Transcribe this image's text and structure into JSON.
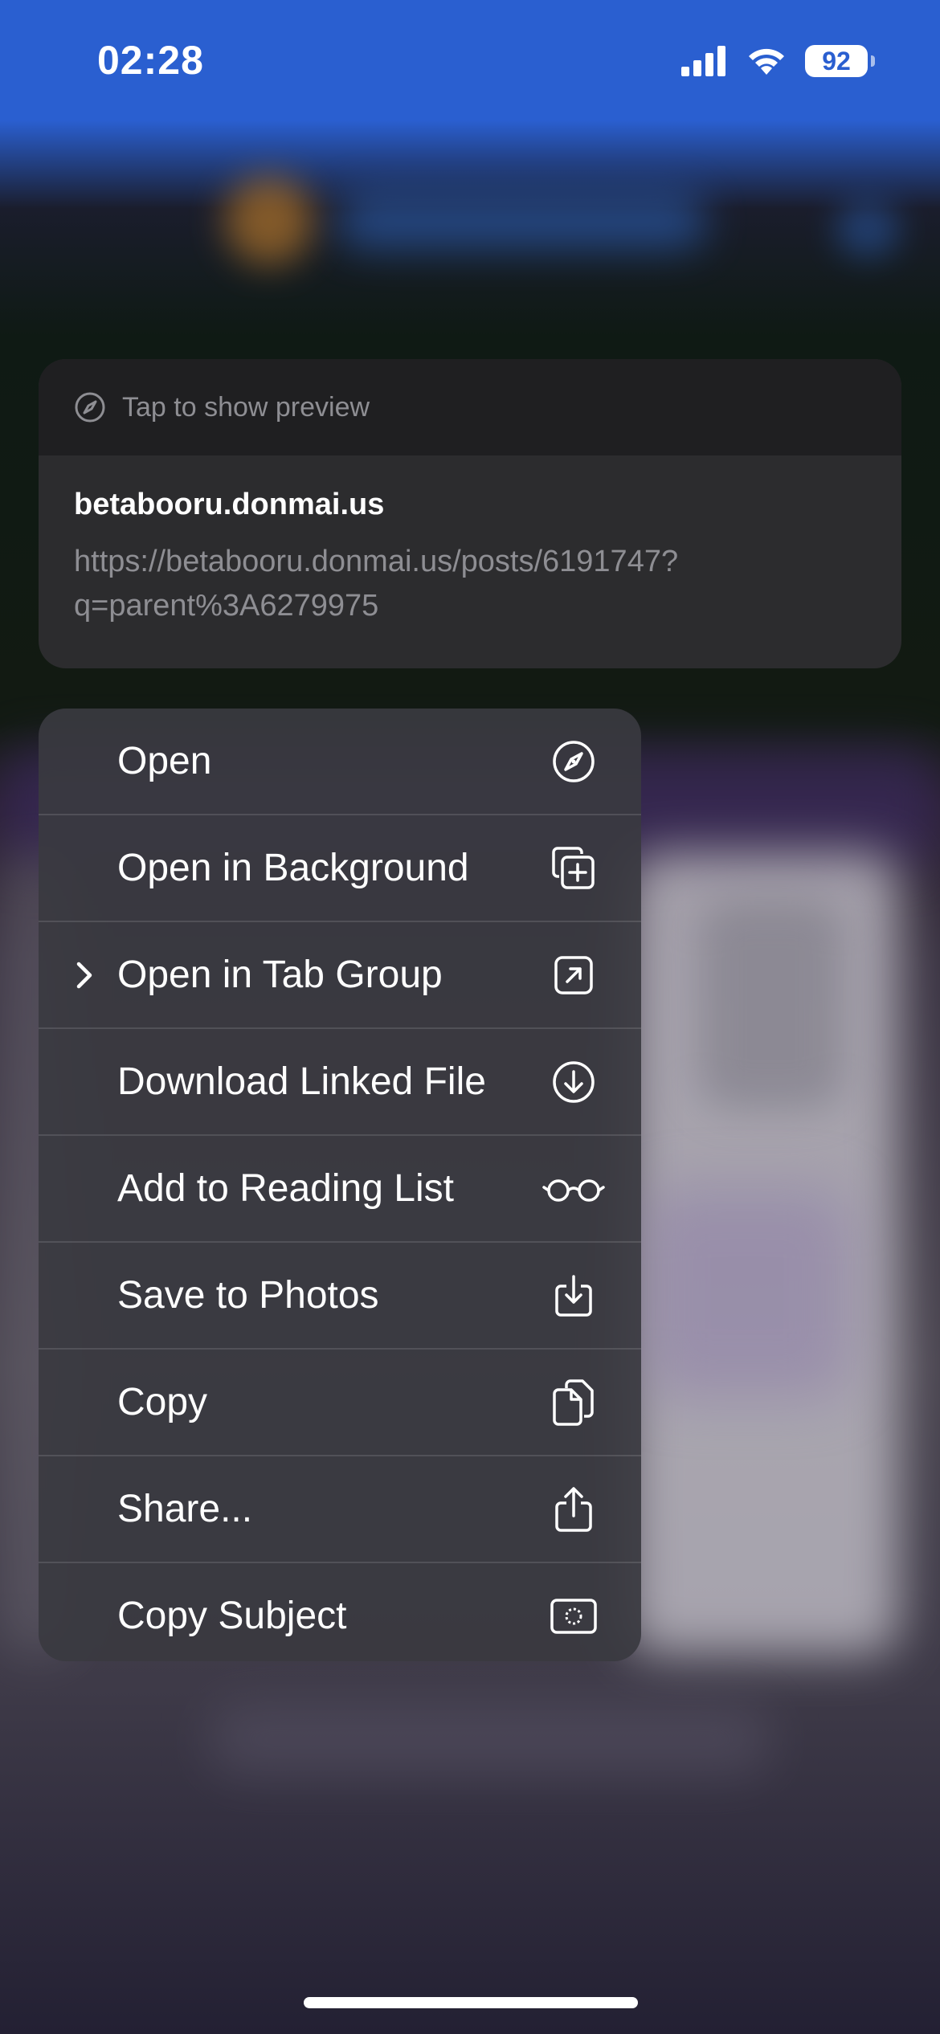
{
  "status_bar": {
    "time": "02:28",
    "battery": "92",
    "icons": [
      "cellular-signal-icon",
      "wifi-icon",
      "battery-icon"
    ]
  },
  "preview": {
    "hint": "Tap to show preview",
    "hint_icon": "compass-icon",
    "title": "betabooru.donmai.us",
    "url": "https://betabooru.donmai.us/posts/6191747?q=parent%3A6279975"
  },
  "menu": {
    "items": [
      {
        "label": "Open",
        "icon": "compass-icon"
      },
      {
        "label": "Open in Background",
        "icon": "plus-square-on-square-icon"
      },
      {
        "label": "Open in Tab Group",
        "icon": "arrow-up-right-square-icon",
        "submenu": true
      },
      {
        "label": "Download Linked File",
        "icon": "arrow-down-circle-icon"
      },
      {
        "label": "Add to Reading List",
        "icon": "eyeglasses-icon"
      },
      {
        "label": "Save to Photos",
        "icon": "square-arrow-down-icon"
      },
      {
        "label": "Copy",
        "icon": "doc-on-doc-icon"
      },
      {
        "label": "Share...",
        "icon": "share-icon"
      },
      {
        "label": "Copy Subject",
        "icon": "viewfinder-icon"
      }
    ]
  },
  "colors": {
    "status_bar_bg": "#2a5fd0",
    "menu_bg": "#3a3a40",
    "preview_bg": "#2c2c2e",
    "secondary_text": "#8e8e93"
  }
}
